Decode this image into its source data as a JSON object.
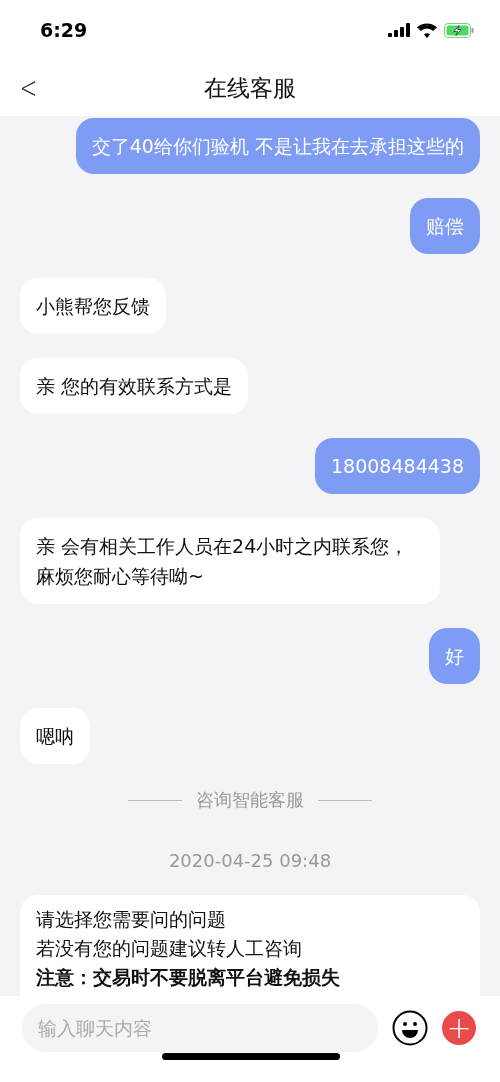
{
  "status_bar": {
    "time": "6:29"
  },
  "header": {
    "back": "<",
    "title": "在线客服"
  },
  "messages": [
    {
      "kind": "sent",
      "text": "交了40给你们验机 不是让我在去承担这些的"
    },
    {
      "kind": "sent",
      "text": "赔偿"
    },
    {
      "kind": "received",
      "text": "小熊帮您反馈"
    },
    {
      "kind": "received",
      "text": "亲 您的有效联系方式是"
    },
    {
      "kind": "sent",
      "text": "18008484438"
    },
    {
      "kind": "received",
      "text": "亲 会有相关工作人员在24小时之内联系您，麻烦您耐心等待呦~"
    },
    {
      "kind": "sent",
      "text": "好"
    },
    {
      "kind": "received",
      "text": "嗯呐"
    }
  ],
  "divider": "咨询智能客服",
  "timestamp": "2020-04-25 09:48",
  "card": {
    "lines": [
      {
        "text": "请选择您需要问的问题",
        "bold": false
      },
      {
        "text": "若没有您的问题建议转人工咨询",
        "bold": false
      },
      {
        "text": "注意：交易时不要脱离平台避免损失",
        "bold": true
      }
    ]
  },
  "input": {
    "placeholder": "输入聊天内容",
    "add": "+"
  }
}
